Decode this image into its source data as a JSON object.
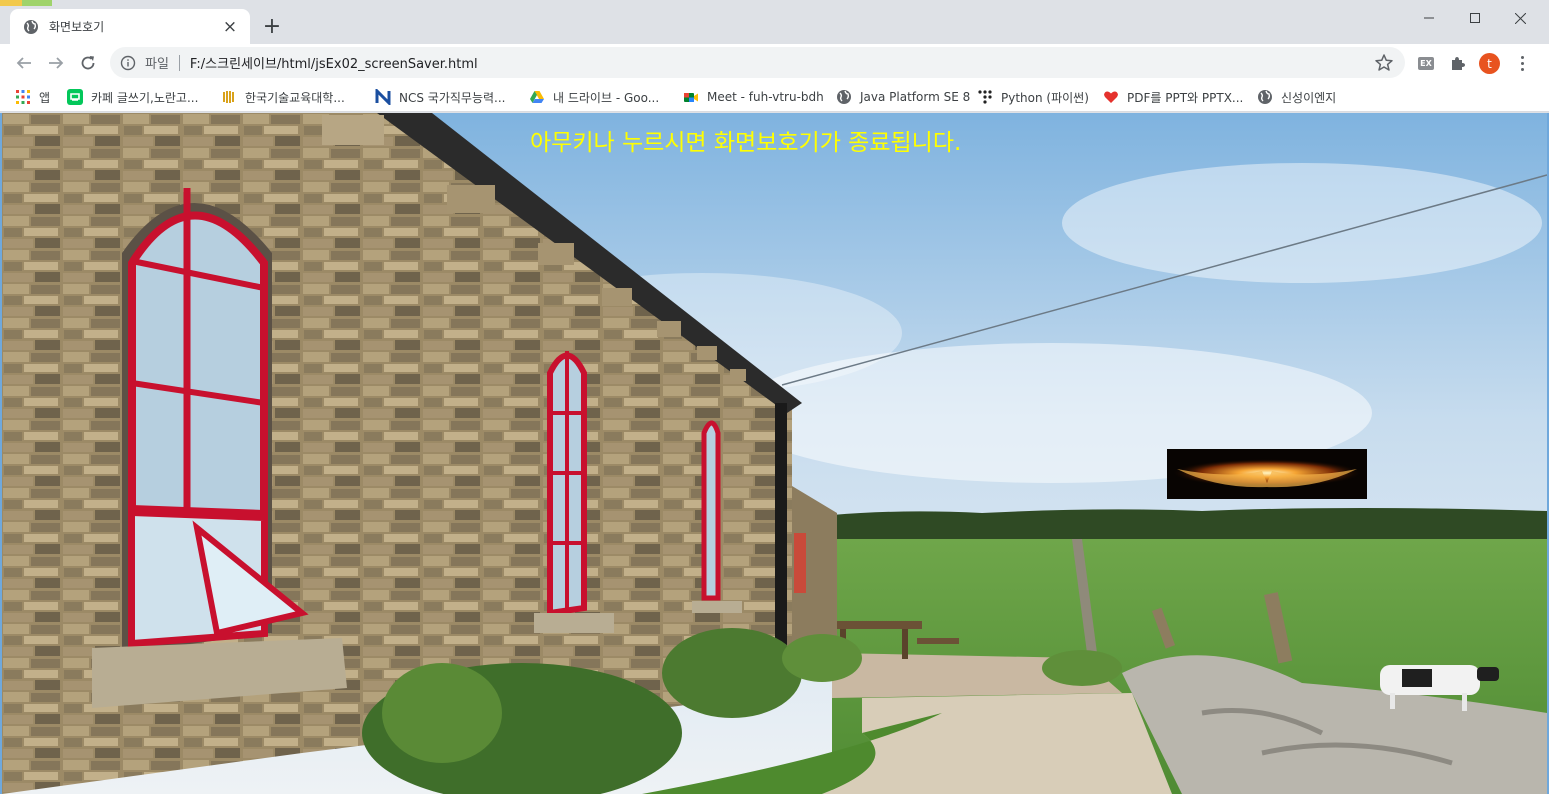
{
  "tab": {
    "title": "화면보호기",
    "close_icon": "close-icon"
  },
  "toolbar": {
    "url_scheme": "파일",
    "url": "F:/스크린세이브/html/jsEx02_screenSaver.html",
    "avatar_letter": "t",
    "ext_label": "EX"
  },
  "bookmarks": [
    {
      "label": "앱",
      "icon": "apps-grid-icon"
    },
    {
      "label": "카페 글쓰기,노란고...",
      "icon": "cafe-icon"
    },
    {
      "label": "한국기술교육대학...",
      "icon": "koreatech-icon"
    },
    {
      "label": "NCS 국가직무능력...",
      "icon": "ncs-icon"
    },
    {
      "label": "내 드라이브 - Goo...",
      "icon": "google-drive-icon"
    },
    {
      "label": "Meet - fuh-vtru-bdh",
      "icon": "google-meet-icon"
    },
    {
      "label": "Java Platform SE 8",
      "icon": "globe-icon"
    },
    {
      "label": "Python (파이썬)",
      "icon": "python-dots-icon"
    },
    {
      "label": "PDF를 PPT와 PPTX...",
      "icon": "pdf-heart-icon"
    },
    {
      "label": "신성이엔지",
      "icon": "globe-icon"
    }
  ],
  "page": {
    "message": "아무키나 누르시면 화면보호기가 종료됩니다.",
    "message_color": "#ffff00"
  },
  "colors": {
    "tab_strip": "#dee1e6",
    "avatar": "#e8531f",
    "window_frame": "#e53935"
  }
}
